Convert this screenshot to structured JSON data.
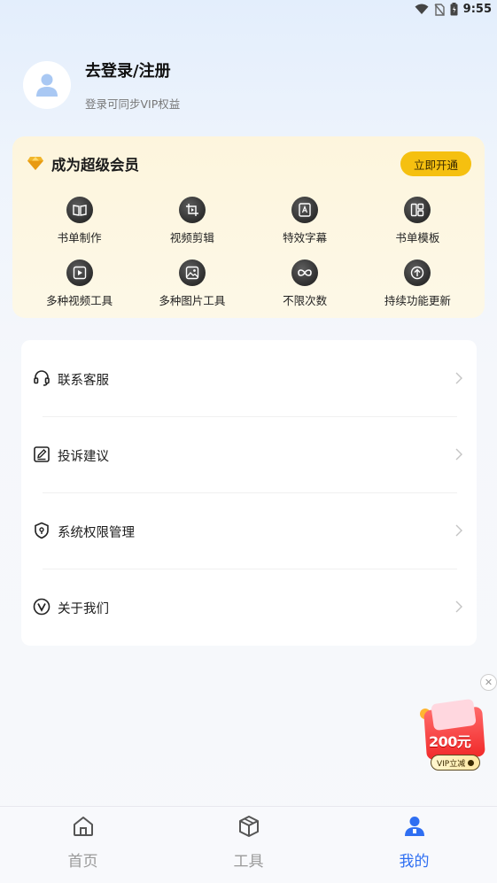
{
  "status_bar": {
    "time": "9:55"
  },
  "profile": {
    "title": "去登录/注册",
    "subtitle": "登录可同步VIP权益"
  },
  "vip": {
    "title": "成为超级会员",
    "button": "立即开通",
    "features": [
      {
        "label": "书单制作",
        "icon": "book-icon"
      },
      {
        "label": "视频剪辑",
        "icon": "video-crop-icon"
      },
      {
        "label": "特效字幕",
        "icon": "subtitle-icon"
      },
      {
        "label": "书单模板",
        "icon": "template-icon"
      },
      {
        "label": "多种视频工具",
        "icon": "video-play-icon"
      },
      {
        "label": "多种图片工具",
        "icon": "image-icon"
      },
      {
        "label": "不限次数",
        "icon": "infinity-icon"
      },
      {
        "label": "持续功能更新",
        "icon": "update-arrow-icon"
      }
    ]
  },
  "menu": [
    {
      "label": "联系客服",
      "icon": "headset-icon"
    },
    {
      "label": "投诉建议",
      "icon": "edit-note-icon"
    },
    {
      "label": "系统权限管理",
      "icon": "shield-icon"
    },
    {
      "label": "关于我们",
      "icon": "v-logo-icon"
    }
  ],
  "promo": {
    "amount": "200元",
    "tag": "VIP立减"
  },
  "bottom_nav": [
    {
      "label": "首页",
      "icon": "home-icon",
      "active": false
    },
    {
      "label": "工具",
      "icon": "box-icon",
      "active": false
    },
    {
      "label": "我的",
      "icon": "user-icon",
      "active": true
    }
  ],
  "colors": {
    "accent": "#2f6ff2",
    "vip_button": "#f5c010",
    "vip_card": "#fdf6e0"
  }
}
